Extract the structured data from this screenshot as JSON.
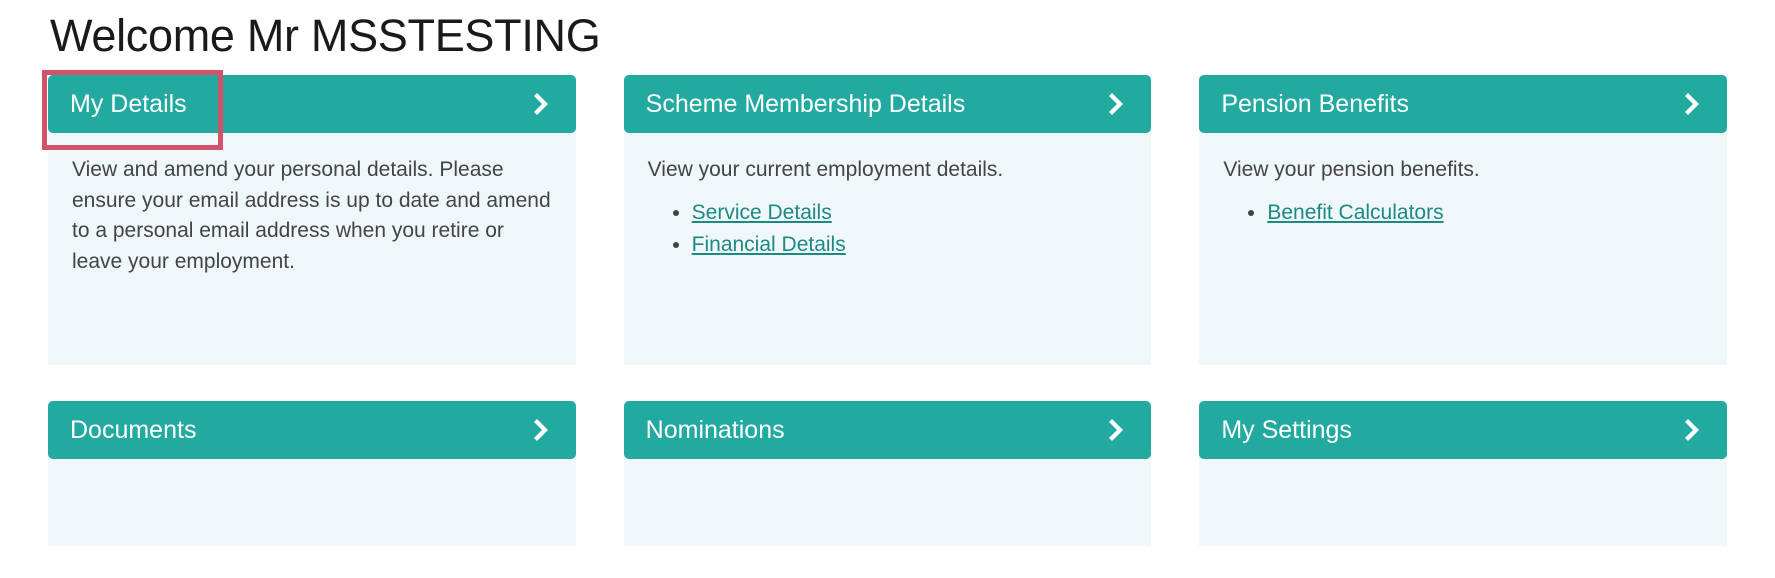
{
  "page": {
    "title": "Welcome Mr MSSTESTING",
    "accent_color": "#22a9a0",
    "card_body_color": "#f0f7f8",
    "link_color": "#1b8a85",
    "highlight_color": "#d1536a"
  },
  "cards": [
    {
      "title": "My Details",
      "description": "View and amend your personal details. Please ensure your email address is up to date and amend to a personal email address when you retire or leave your employment.",
      "links": [],
      "icon": "chevron-right-icon",
      "highlighted": true
    },
    {
      "title": "Scheme Membership Details",
      "description": "View your current employment details.",
      "links": [
        "Service Details",
        "Financial Details"
      ],
      "icon": "chevron-right-icon",
      "highlighted": false
    },
    {
      "title": "Pension Benefits",
      "description": "View your pension benefits.",
      "links": [
        "Benefit Calculators"
      ],
      "icon": "chevron-right-icon",
      "highlighted": false
    },
    {
      "title": "Documents",
      "description": "",
      "links": [],
      "icon": "chevron-right-icon",
      "highlighted": false
    },
    {
      "title": "Nominations",
      "description": "",
      "links": [],
      "icon": "chevron-right-icon",
      "highlighted": false
    },
    {
      "title": "My Settings",
      "description": "",
      "links": [],
      "icon": "chevron-right-icon",
      "highlighted": false
    }
  ]
}
